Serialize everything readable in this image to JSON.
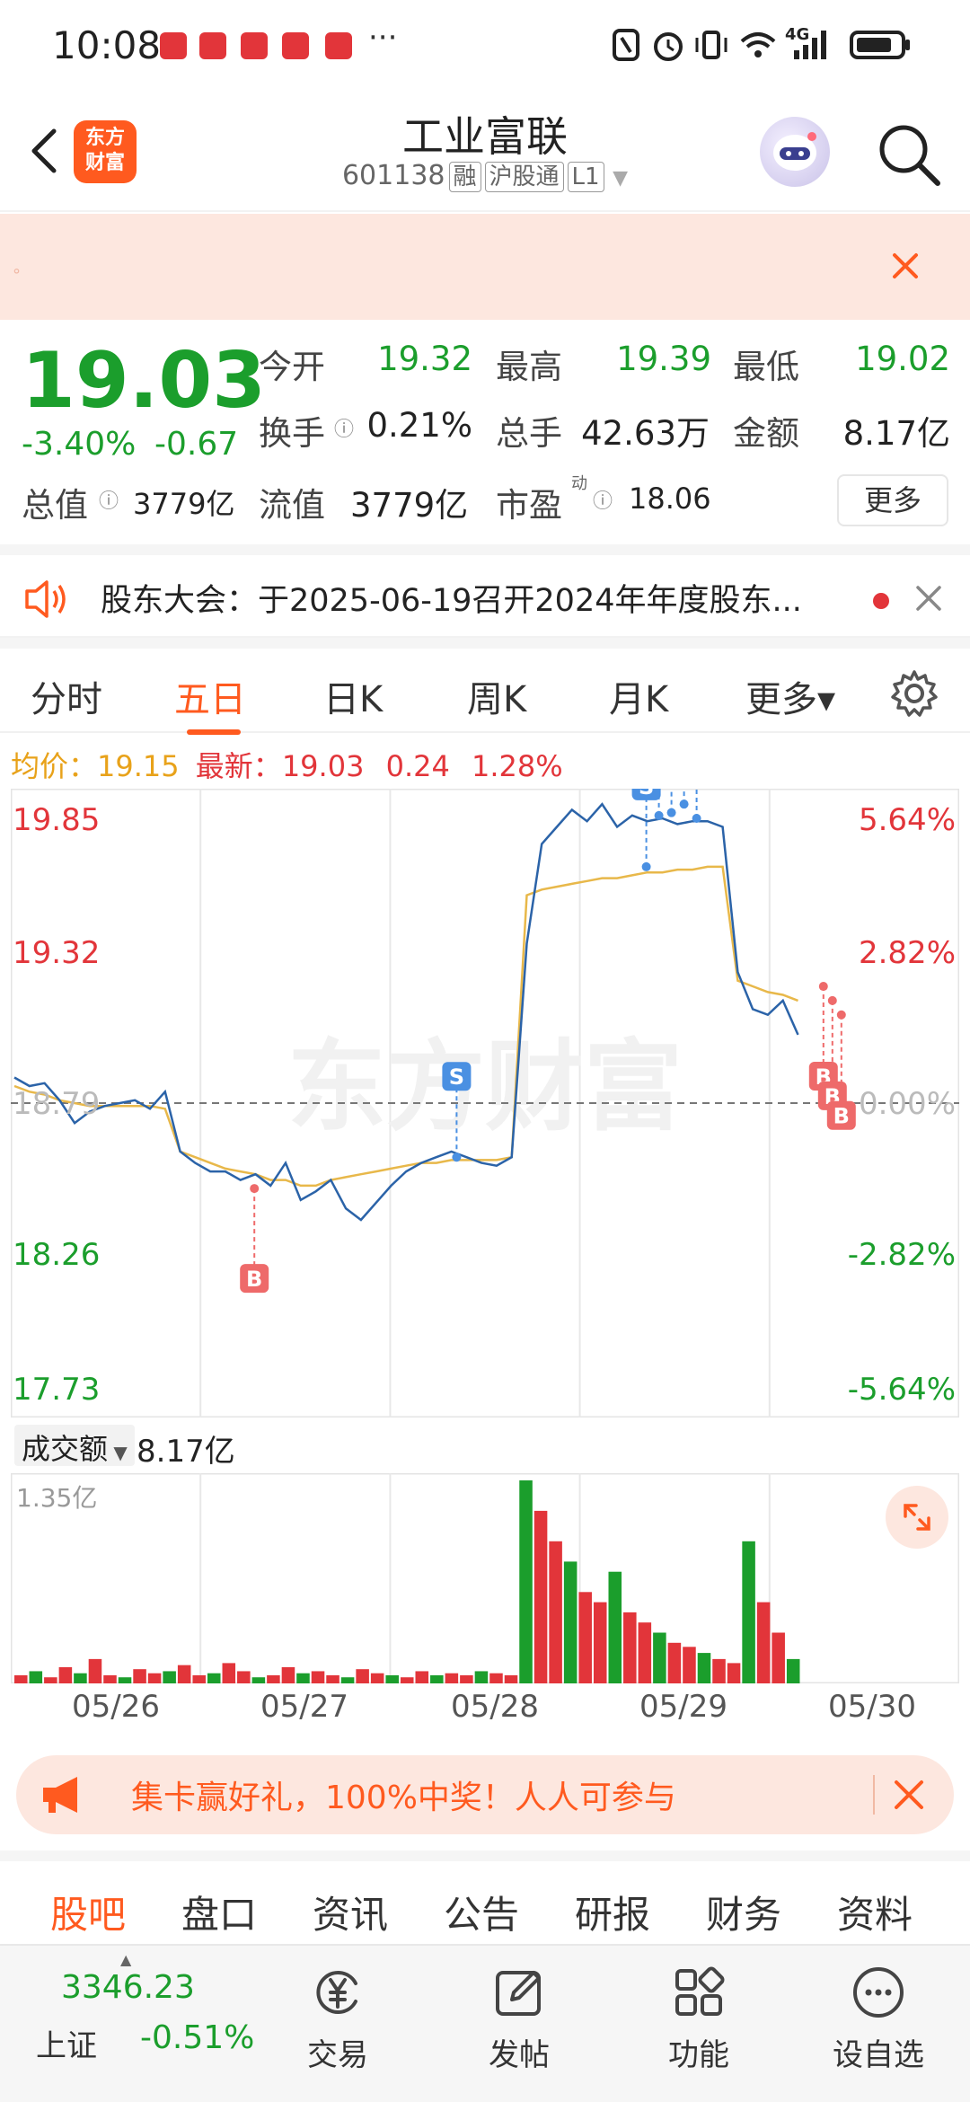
{
  "status": {
    "time": "10:08",
    "more": "···",
    "network": "4G"
  },
  "header": {
    "back_icon": "chevron-left-icon",
    "logo_text": [
      "东方",
      "财富"
    ],
    "stock_name": "工业富联",
    "stock_code": "601138",
    "tags": [
      "融",
      "沪股通",
      "L1"
    ],
    "search_icon": "search-icon"
  },
  "banner": {
    "text": "",
    "close_icon": "close-icon"
  },
  "quote": {
    "last_price": "19.03",
    "change_pct": "-3.40%",
    "change_amt": "-0.67",
    "fields": {
      "open_label": "今开",
      "open_value": "19.32",
      "high_label": "最高",
      "high_value": "19.39",
      "low_label": "最低",
      "low_value": "19.02",
      "turnover_label": "换手",
      "turnover_value": "0.21%",
      "volume_label": "总手",
      "volume_value": "42.63万",
      "amount_label": "金额",
      "amount_value": "8.17亿",
      "mktcap_label": "总值",
      "mktcap_value": "3779亿",
      "float_label": "流值",
      "float_value": "3779亿",
      "pe_label": "市盈",
      "pe_sup": "动",
      "pe_value": "18.06"
    },
    "more_label": "更多"
  },
  "notice": {
    "text": "股东大会：于2025-06-19召开2024年年度股东...",
    "icon": "speaker-icon"
  },
  "chart_tabs": [
    "分时",
    "五日",
    "日K",
    "周K",
    "月K",
    "更多▾"
  ],
  "active_chart_tab": 1,
  "info_line": {
    "avg_label": "均价：",
    "avg_value": "19.15",
    "latest_label": "最新：",
    "latest_value": "19.03",
    "change_amt": "0.24",
    "change_pct": "1.28%"
  },
  "volume": {
    "label": "成交额",
    "value": "8.17亿",
    "max_label": "1.35亿"
  },
  "chart_data": {
    "type": "line",
    "title": "",
    "x": [
      "05/26",
      "05/27",
      "05/28",
      "05/29",
      "05/30"
    ],
    "y_left_ticks": [
      "19.85",
      "19.32",
      "18.79",
      "18.26",
      "17.73"
    ],
    "y_right_ticks": [
      "5.64%",
      "2.82%",
      "0.00%",
      "-2.82%",
      "-5.64%"
    ],
    "ylim": [
      17.73,
      19.85
    ],
    "reference_price": 18.79,
    "series": [
      {
        "values": [
          18.88,
          18.85,
          18.86,
          18.8,
          18.72,
          18.76,
          18.78,
          18.79,
          18.8,
          18.77,
          18.83,
          18.62,
          18.58,
          18.55,
          18.55,
          18.52,
          18.54,
          18.5,
          18.58,
          18.45,
          18.48,
          18.52,
          18.42,
          18.38,
          18.44,
          18.5,
          18.55,
          18.58,
          18.6,
          18.62,
          18.6,
          18.58,
          18.57,
          18.6,
          19.35,
          19.7,
          19.76,
          19.82,
          19.78,
          19.84,
          19.76,
          19.8,
          19.78,
          19.79,
          19.77,
          19.78,
          19.78,
          19.76,
          19.25,
          19.12,
          19.1,
          19.15,
          19.03
        ]
      },
      {
        "values": [
          18.85,
          18.83,
          18.82,
          18.8,
          18.79,
          18.78,
          18.78,
          18.78,
          18.78,
          18.78,
          18.77,
          18.62,
          18.6,
          18.58,
          18.56,
          18.55,
          18.54,
          18.52,
          18.52,
          18.5,
          18.5,
          18.52,
          18.53,
          18.54,
          18.55,
          18.56,
          18.57,
          18.58,
          18.58,
          18.59,
          18.59,
          18.59,
          18.59,
          18.6,
          19.52,
          19.54,
          19.55,
          19.56,
          19.57,
          19.58,
          19.58,
          19.59,
          19.6,
          19.6,
          19.61,
          19.61,
          19.62,
          19.62,
          19.22,
          19.2,
          19.18,
          19.17,
          19.15
        ]
      }
    ],
    "markers": [
      {
        "label": "B",
        "x_day": "05/27",
        "price": 18.49
      },
      {
        "label": "S",
        "x_day": "05/28",
        "price": 18.6
      },
      {
        "label": "S",
        "x_day": "05/29",
        "price": 19.62
      },
      {
        "label": "S",
        "x_day": "05/29",
        "price": 19.8
      },
      {
        "label": "S",
        "x_day": "05/29",
        "price": 19.81
      },
      {
        "label": "S",
        "x_day": "05/29",
        "price": 19.84
      },
      {
        "label": "S",
        "x_day": "05/29",
        "price": 19.79
      },
      {
        "label": "B",
        "x_day": "05/30",
        "price": 19.2
      },
      {
        "label": "B",
        "x_day": "05/30",
        "price": 19.15
      },
      {
        "label": "B",
        "x_day": "05/30",
        "price": 19.1
      }
    ],
    "watermark": "东方财富",
    "volume_bars": [
      4,
      6,
      3,
      8,
      5,
      12,
      4,
      3,
      7,
      5,
      6,
      9,
      4,
      5,
      10,
      6,
      3,
      4,
      8,
      5,
      6,
      4,
      3,
      7,
      5,
      4,
      3,
      6,
      4,
      5,
      4,
      6,
      5,
      4,
      100,
      85,
      70,
      60,
      45,
      40,
      55,
      35,
      30,
      25,
      20,
      18,
      15,
      12,
      10,
      70,
      40,
      25,
      12
    ],
    "volume_max": 1.35
  },
  "promo": {
    "icon": "megaphone-icon",
    "text": "集卡赢好礼，100%中奖！人人可参与",
    "close_icon": "close-icon"
  },
  "bottom_tabs": [
    "股吧",
    "盘口",
    "资讯",
    "公告",
    "研报",
    "财务",
    "资料"
  ],
  "active_bottom_tab": 0,
  "bottombar": {
    "index_value": "3346.23",
    "index_name": "上证",
    "index_pct": "-0.51%",
    "items": [
      {
        "icon": "trade-yen-icon",
        "label": "交易"
      },
      {
        "icon": "edit-post-icon",
        "label": "发帖"
      },
      {
        "icon": "grid-apps-icon",
        "label": "功能"
      },
      {
        "icon": "more-dots-icon",
        "label": "设自选"
      }
    ]
  },
  "colors": {
    "accent": "#ff5a1f",
    "up": "#e2353a",
    "down": "#1b9e2c",
    "price_line": "#2b63a8",
    "avg_line": "#e8b84a"
  }
}
